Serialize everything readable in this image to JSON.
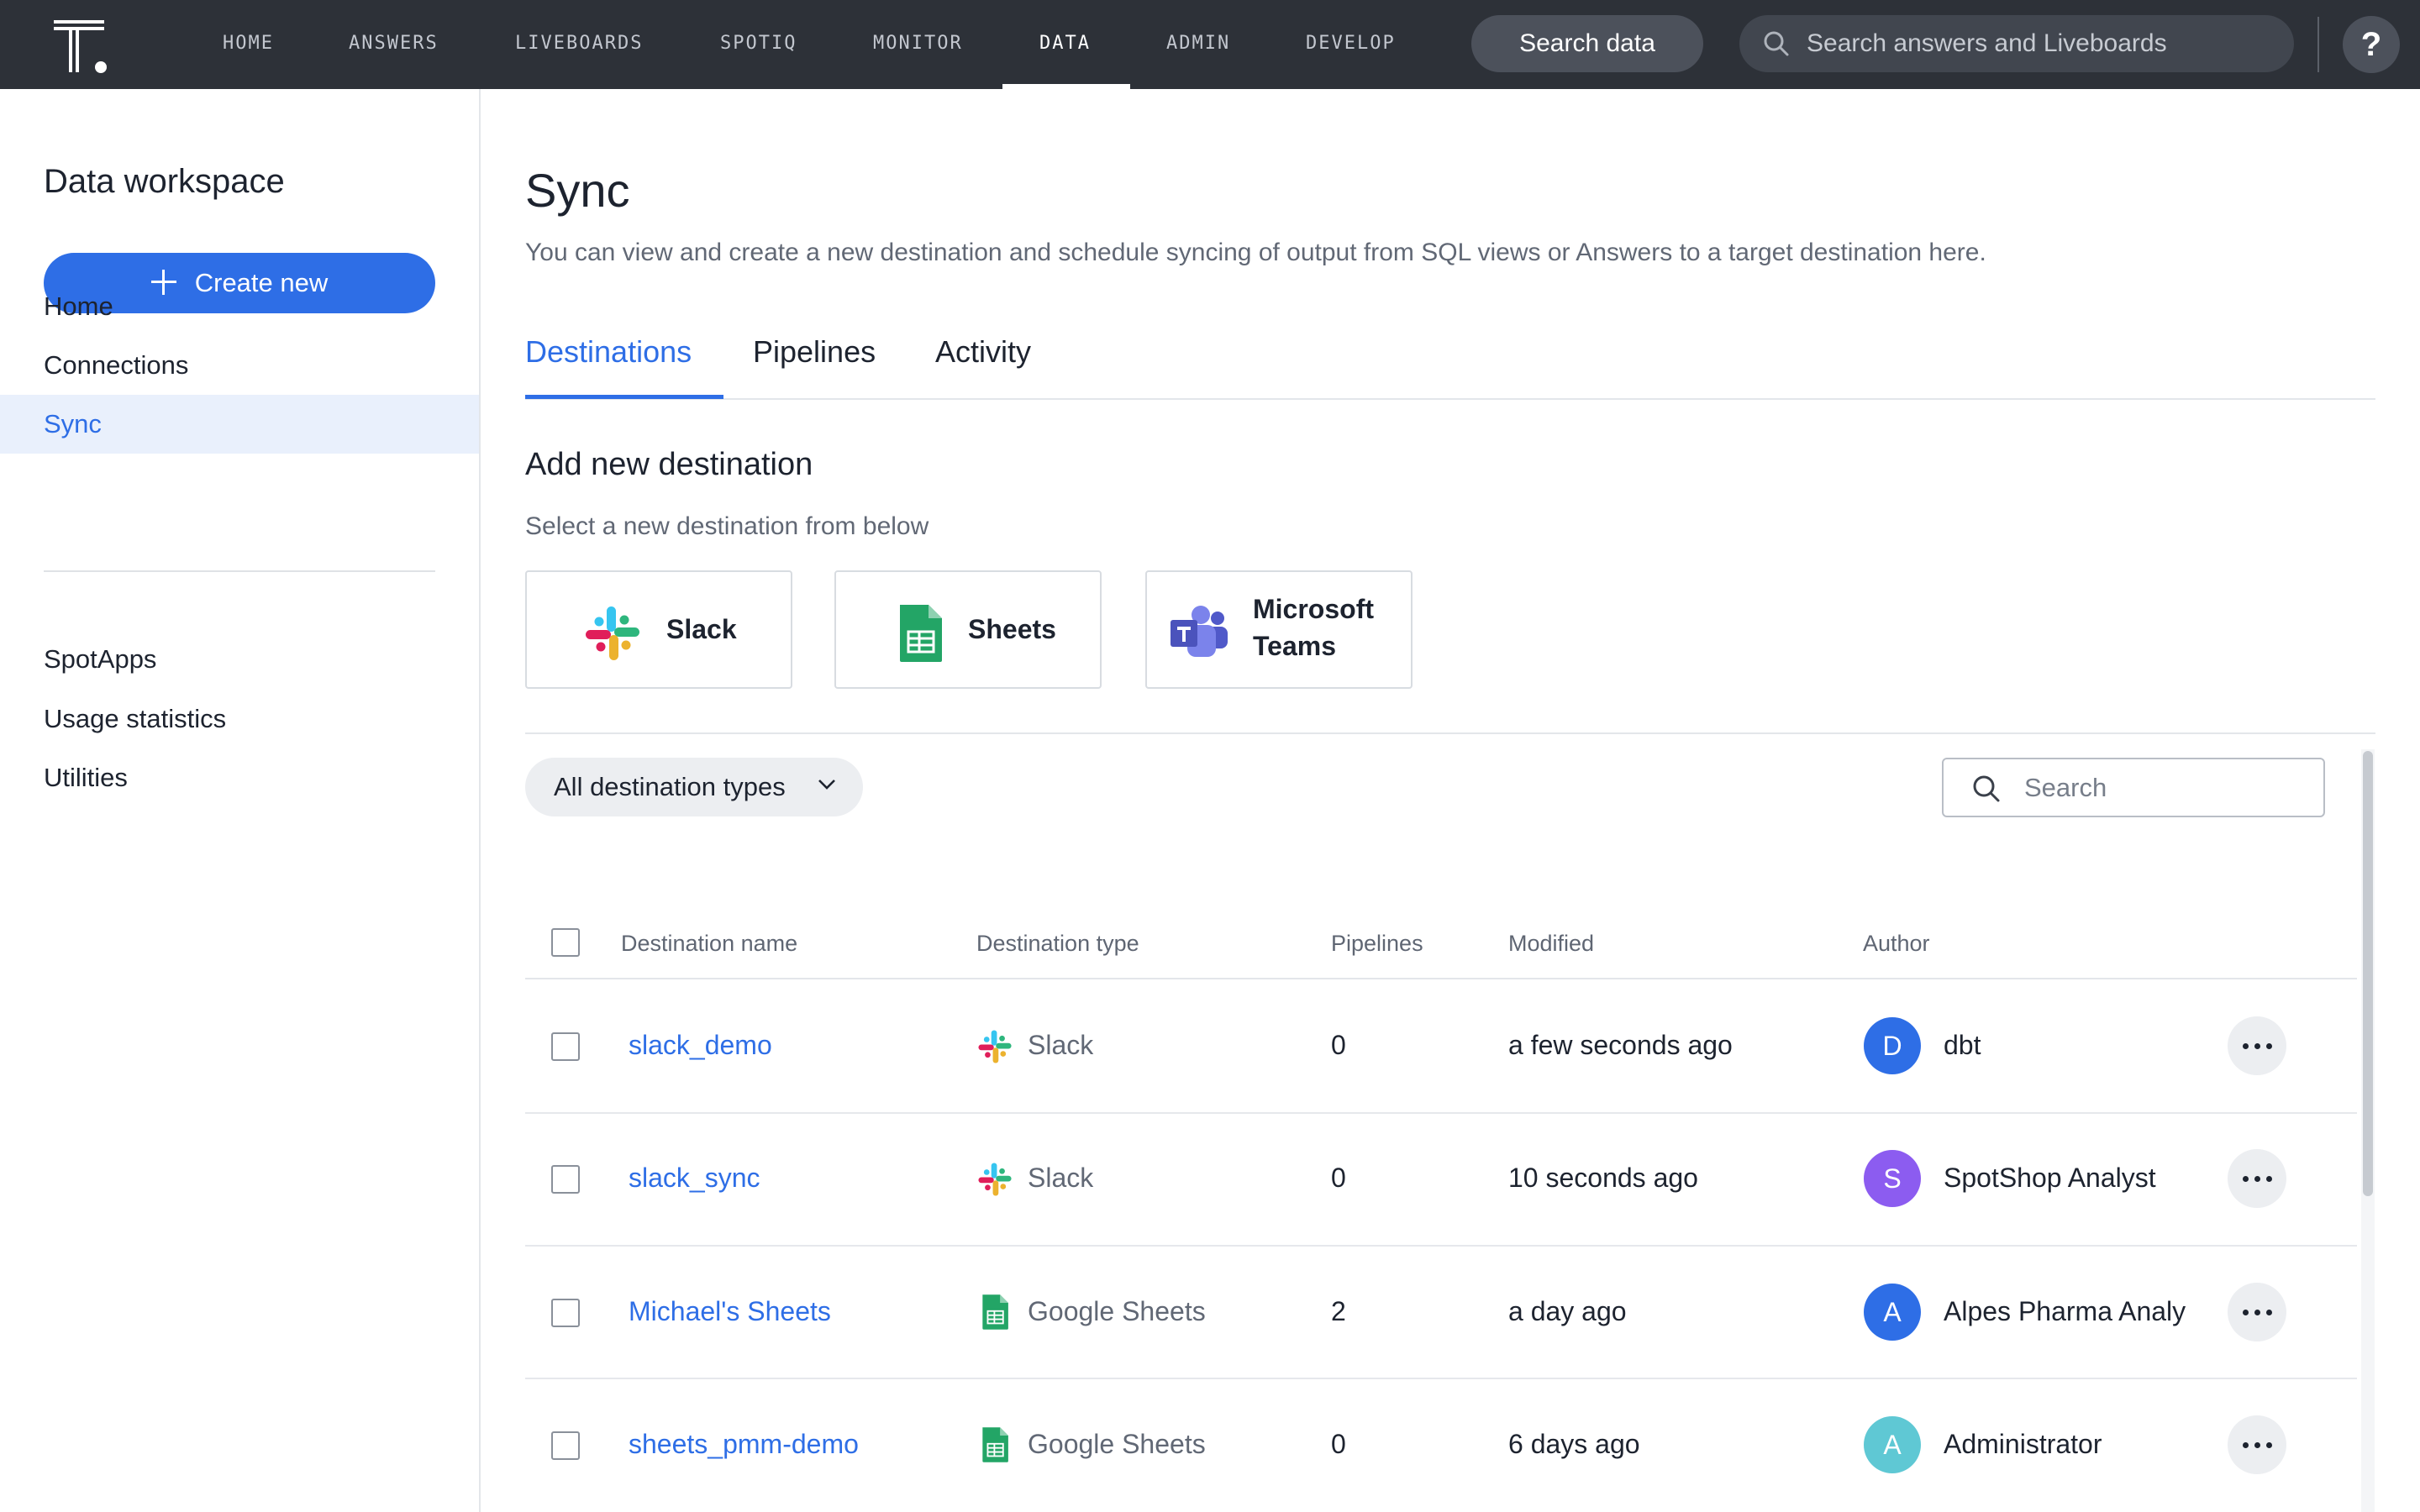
{
  "nav": {
    "items": [
      "HOME",
      "ANSWERS",
      "LIVEBOARDS",
      "SPOTIQ",
      "MONITOR",
      "DATA",
      "ADMIN",
      "DEVELOP"
    ],
    "active": "DATA",
    "search_data_label": "Search data",
    "global_search_placeholder": "Search answers and Liveboards",
    "help_label": "?"
  },
  "sidebar": {
    "title": "Data workspace",
    "create_label": "Create new",
    "items": [
      "Home",
      "Connections",
      "Sync"
    ],
    "active": "Sync",
    "secondary_items": [
      "SpotApps",
      "Usage statistics",
      "Utilities"
    ]
  },
  "main": {
    "title": "Sync",
    "description": "You can view and create a new destination and schedule syncing of output from SQL views or Answers to a target destination here.",
    "tabs": [
      "Destinations",
      "Pipelines",
      "Activity"
    ],
    "active_tab": "Destinations",
    "add_title": "Add new destination",
    "add_subtitle": "Select a new destination from below",
    "destinations": [
      {
        "label": "Slack",
        "icon": "slack-icon"
      },
      {
        "label": "Sheets",
        "icon": "google-sheets-icon"
      },
      {
        "label_line1": "Microsoft",
        "label_line2": "Teams",
        "icon": "microsoft-teams-icon"
      }
    ],
    "filter_label": "All destination types",
    "table_search_placeholder": "Search"
  },
  "table": {
    "columns": [
      "Destination name",
      "Destination type",
      "Pipelines",
      "Modified",
      "Author"
    ],
    "rows": [
      {
        "name": "slack_demo",
        "type": "Slack",
        "type_icon": "slack-icon",
        "pipelines": "0",
        "modified": "a few seconds ago",
        "author_initial": "D",
        "author": "dbt",
        "avatar_color": "#2e6ee6"
      },
      {
        "name": "slack_sync",
        "type": "Slack",
        "type_icon": "slack-icon",
        "pipelines": "0",
        "modified": "10 seconds ago",
        "author_initial": "S",
        "author": "SpotShop Analyst",
        "avatar_color": "#8c5cf0"
      },
      {
        "name": "Michael's Sheets",
        "type": "Google Sheets",
        "type_icon": "google-sheets-icon",
        "pipelines": "2",
        "modified": "a day ago",
        "author_initial": "A",
        "author": "Alpes Pharma Analy",
        "avatar_color": "#2e6ee6"
      },
      {
        "name": "sheets_pmm-demo",
        "type": "Google Sheets",
        "type_icon": "google-sheets-icon",
        "pipelines": "0",
        "modified": "6 days ago",
        "author_initial": "A",
        "author": "Administrator",
        "avatar_color": "#5fc8d4"
      }
    ]
  },
  "colors": {
    "accent": "#2e6ee6",
    "topbar": "#2d3138",
    "slack_blue": "#36c5f0",
    "slack_green": "#2eb67d",
    "slack_red": "#e01e5a",
    "slack_yellow": "#ecb22e",
    "sheets_green": "#23a566",
    "teams_purple": "#5059c9"
  }
}
